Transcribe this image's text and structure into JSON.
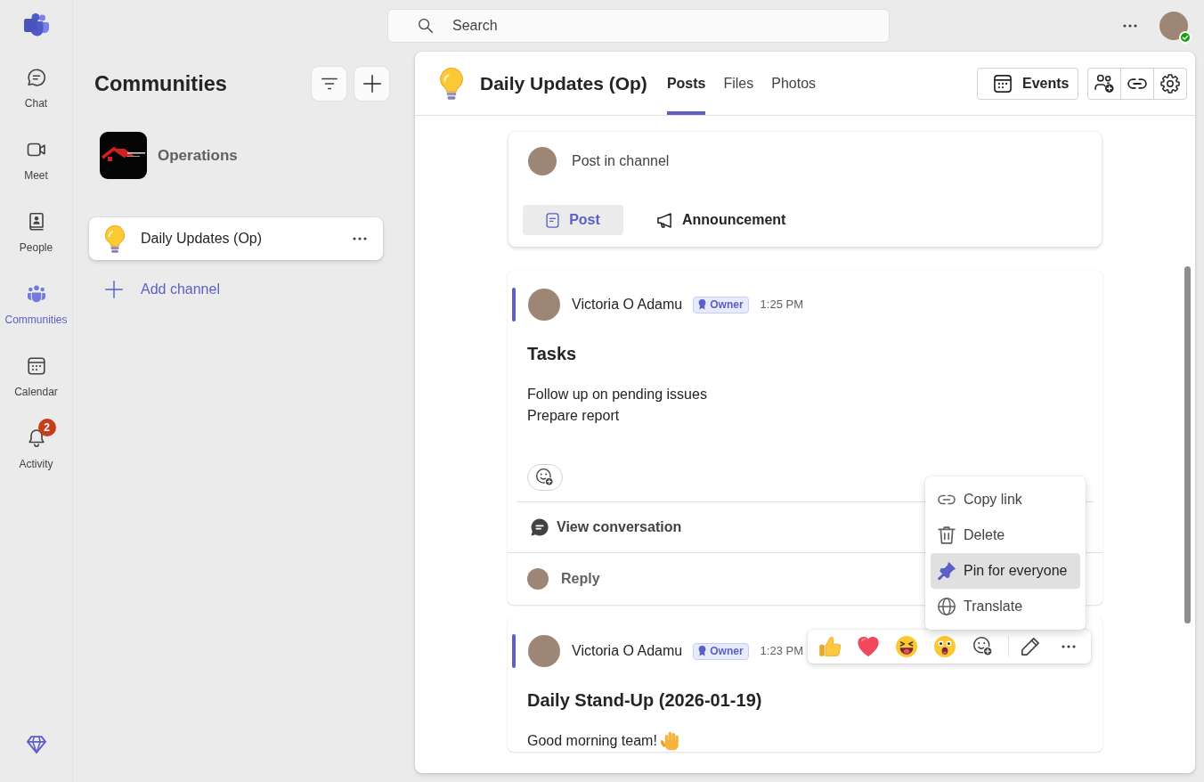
{
  "rail": {
    "items": [
      {
        "kind": "chat",
        "label": "Chat",
        "selected": false
      },
      {
        "kind": "meet",
        "label": "Meet",
        "selected": false
      },
      {
        "kind": "people",
        "label": "People",
        "selected": false
      },
      {
        "kind": "communities",
        "label": "Communities",
        "selected": true
      },
      {
        "kind": "calendar",
        "label": "Calendar",
        "selected": false
      },
      {
        "kind": "activity",
        "label": "Activity",
        "selected": false,
        "badge": "2"
      }
    ]
  },
  "top_bar": {
    "search": {
      "placeholder": "Search"
    },
    "user": {
      "available": true
    }
  },
  "sidebar": {
    "title": "Communities",
    "community": {
      "name": "Operations"
    },
    "channels": [
      {
        "name": "Daily Updates (Op)",
        "selected": true
      }
    ],
    "add_channel": "Add channel"
  },
  "channel": {
    "title": "Daily Updates (Op)",
    "tabs": [
      {
        "label": "Posts",
        "selected": true
      },
      {
        "label": "Files",
        "selected": false
      },
      {
        "label": "Photos",
        "selected": false
      }
    ],
    "events_button": "Events"
  },
  "composer": {
    "placeholder": "Post in channel",
    "modes": [
      {
        "kind": "post",
        "label": "Post",
        "selected": true
      },
      {
        "kind": "announcement",
        "label": "Announcement",
        "selected": false
      }
    ]
  },
  "posts": [
    {
      "author": "Victoria O Adamu",
      "role": "Owner",
      "time": "1:25 PM",
      "title": "Tasks",
      "lines": [
        {
          "text": "Follow up on pending issues",
          "emoji": false
        },
        {
          "text": "Prepare report",
          "emoji": false
        }
      ],
      "hovered": false,
      "view_conversation": "View conversation",
      "reply": "Reply"
    },
    {
      "author": "Victoria O Adamu",
      "role": "Owner",
      "time": "1:23 PM",
      "title": "Daily Stand-Up (2026-01-19)",
      "lines": [
        {
          "text": "Good morning team!",
          "emoji": true
        }
      ],
      "hovered": true
    }
  ],
  "context_menu": {
    "items": [
      {
        "kind": "copy-link",
        "label": "Copy link",
        "selected": false
      },
      {
        "kind": "delete",
        "label": "Delete",
        "selected": false
      },
      {
        "kind": "pin",
        "label": "Pin for everyone",
        "selected": true
      },
      {
        "kind": "translate",
        "label": "Translate",
        "selected": false
      }
    ]
  }
}
